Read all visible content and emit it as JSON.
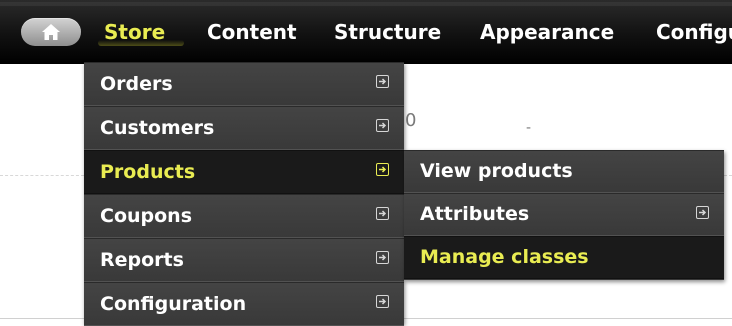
{
  "toolbar": {
    "home_icon": "home-icon",
    "items": [
      {
        "label": "Store",
        "active": true
      },
      {
        "label": "Content"
      },
      {
        "label": "Structure"
      },
      {
        "label": "Appearance"
      },
      {
        "label": "Configu"
      }
    ]
  },
  "background": {
    "fragment_1": "0",
    "fragment_2": "-"
  },
  "store_menu": {
    "items": [
      {
        "label": "Orders",
        "icon": "arrow-right-icon"
      },
      {
        "label": "Customers",
        "icon": "arrow-right-icon"
      },
      {
        "label": "Products",
        "icon": "arrow-right-icon",
        "active": true
      },
      {
        "label": "Coupons",
        "icon": "arrow-right-icon"
      },
      {
        "label": "Reports",
        "icon": "arrow-right-icon"
      },
      {
        "label": "Configuration",
        "icon": "arrow-right-icon"
      }
    ]
  },
  "products_submenu": {
    "items": [
      {
        "label": "View products"
      },
      {
        "label": "Attributes",
        "icon": "arrow-right-icon"
      },
      {
        "label": "Manage classes",
        "active": true
      }
    ]
  },
  "colors": {
    "toolbar_bg": "#000000",
    "menu_bg": "#383838",
    "active_text": "#e9ec52",
    "text": "#ffffff"
  }
}
